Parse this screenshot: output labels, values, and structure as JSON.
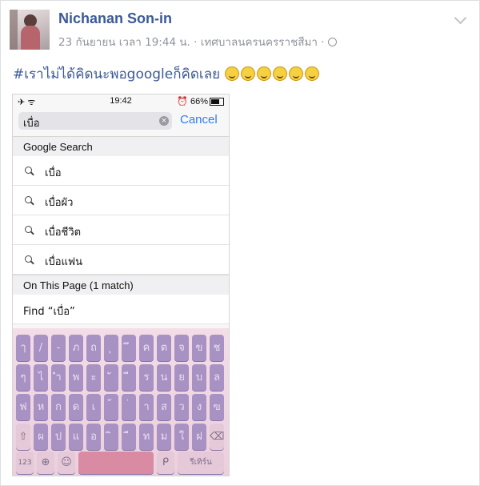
{
  "post": {
    "author": "Nichanan Son-in",
    "meta": "23 กันยายน เวลา 19:44 น. · เทศบาลนครนครราชสีมา ·",
    "text": "#เราไม่ได้คิดนะพอgoogleก็คิดเลย",
    "emoji_count": 6
  },
  "phone": {
    "status": {
      "left": "✈ ᯤ",
      "time": "19:42",
      "right": "⏰ 66%"
    },
    "search": {
      "value": "เบื่อ",
      "clear_glyph": "×",
      "cancel_label": "Cancel"
    },
    "google_header": "Google Search",
    "suggestions": [
      "เบื่อ",
      "เบื่อผัว",
      "เบื่อชีวิต",
      "เบื่อแฟน"
    ],
    "page_header": "On This Page (1 match)",
    "find_label": "Find “เบื่อ”"
  },
  "keyboard": {
    "row1": [
      "ๅ",
      "/",
      "-",
      "ภ",
      "ถ",
      "ุ",
      "ึ",
      "ค",
      "ต",
      "จ",
      "ข",
      "ช"
    ],
    "row2": [
      "ๆ",
      "ไ",
      "ำ",
      "พ",
      "ะ",
      "ั",
      "ี",
      "ร",
      "น",
      "ย",
      "บ",
      "ล"
    ],
    "row3": [
      "ฟ",
      "ห",
      "ก",
      "ด",
      "เ",
      "้",
      "่",
      "า",
      "ส",
      "ว",
      "ง",
      "ฃ"
    ],
    "row4": [
      "ผ",
      "ป",
      "แ",
      "อ",
      "ิ",
      "ื",
      "ท",
      "ม",
      "ใ",
      "ฝ"
    ],
    "shift_glyph": "⇧",
    "delete_glyph": "⌫",
    "num_label": "123",
    "globe_glyph": "⊕",
    "emoji_glyph": "☺",
    "mic_glyph": "ᑭ",
    "return_label": "รีเทิร์น"
  }
}
